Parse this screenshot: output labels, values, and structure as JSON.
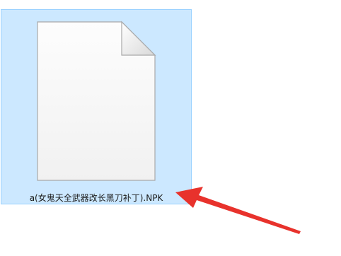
{
  "file": {
    "name": "a(女鬼天全武器改长黑刀补丁).NPK",
    "icon": "blank-document-icon",
    "selected": true
  },
  "annotation": {
    "icon": "red-arrow-icon",
    "color": "#e8322c"
  },
  "colors": {
    "selection_fill": "#cce8ff",
    "selection_border": "#99d1ff"
  }
}
